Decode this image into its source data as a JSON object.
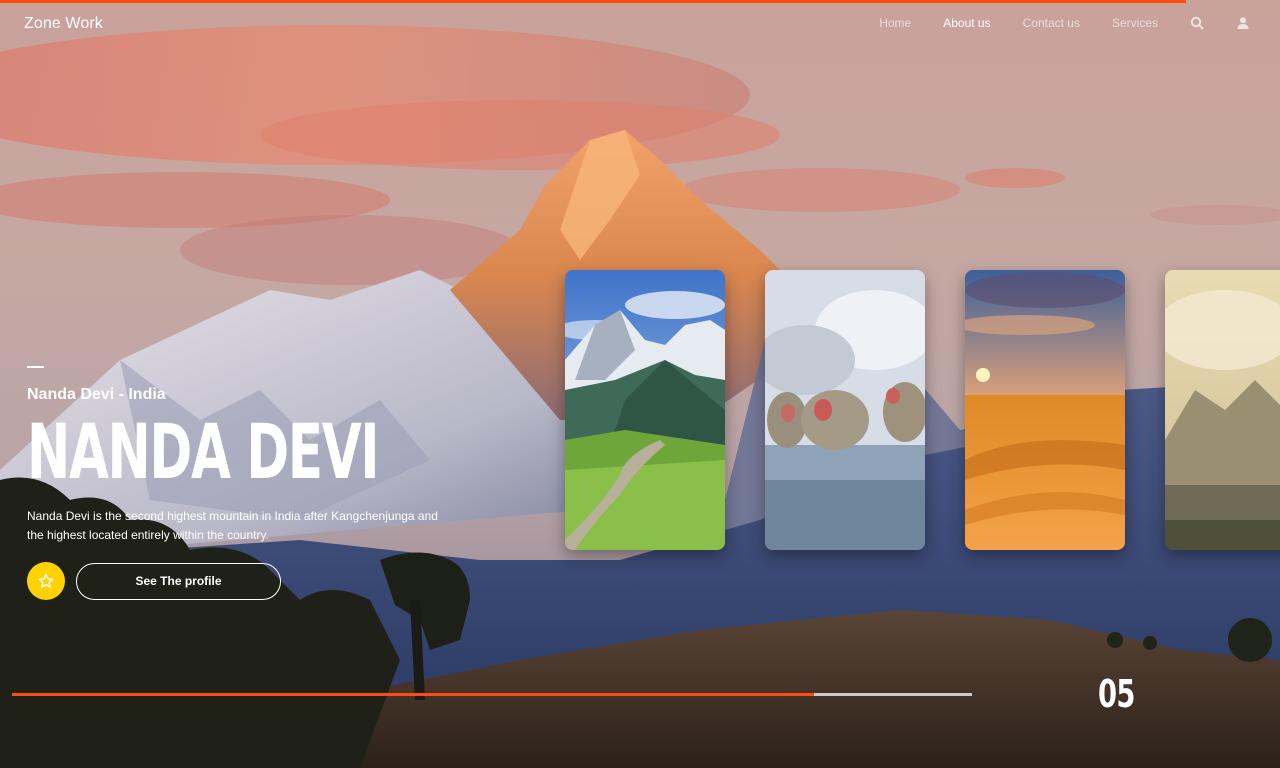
{
  "nav": {
    "brand": "Zone Work",
    "links": [
      {
        "label": "Home",
        "active": false
      },
      {
        "label": "About us",
        "active": true
      },
      {
        "label": "Contact us",
        "active": false
      },
      {
        "label": "Services",
        "active": false
      }
    ],
    "icons": [
      "search-icon",
      "user-icon"
    ]
  },
  "hero": {
    "subtitle": "Nanda Devi - India",
    "title": "NANDA DEVI",
    "description": "Nanda Devi is the second highest mountain in India after Kangchenjunga and the highest located entirely within the country.",
    "favorite_icon": "star-icon",
    "profile_button": "See The profile"
  },
  "cards": [
    {
      "scene": "alpine-valley"
    },
    {
      "scene": "snow-monkeys"
    },
    {
      "scene": "desert-sunset"
    },
    {
      "scene": "misty-lake"
    }
  ],
  "slider": {
    "current": "05",
    "progress": 0.835
  },
  "colors": {
    "accent": "#ff4d12",
    "favorite": "#ffd200"
  }
}
